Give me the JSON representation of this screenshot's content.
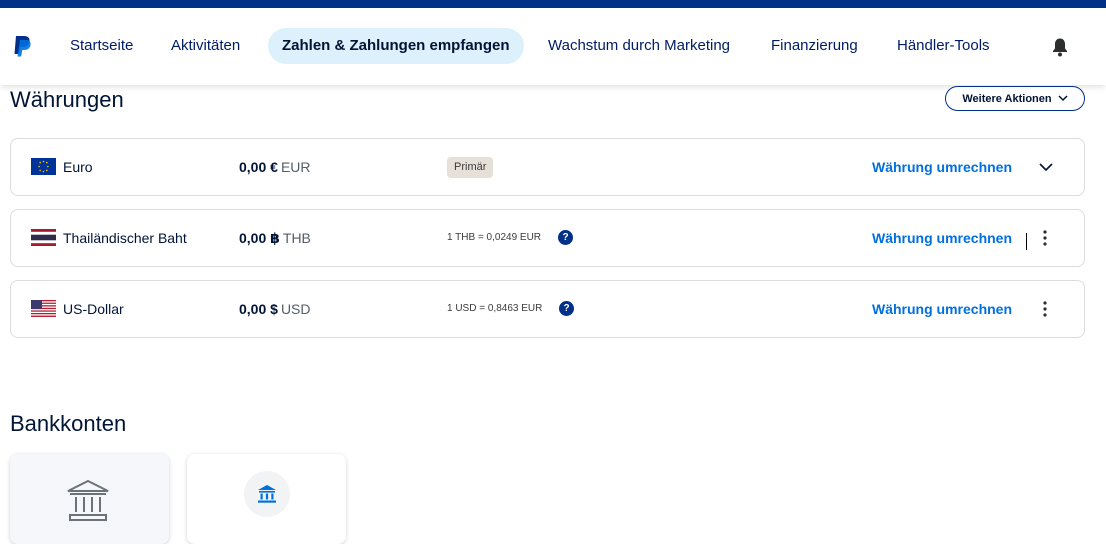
{
  "nav": {
    "items": [
      {
        "label": "Startseite",
        "active": false
      },
      {
        "label": "Aktivitäten",
        "active": false
      },
      {
        "label": "Zahlen & Zahlungen empfangen",
        "active": true
      },
      {
        "label": "Wachstum durch Marketing",
        "active": false
      },
      {
        "label": "Finanzierung",
        "active": false
      },
      {
        "label": "Händler-Tools",
        "active": false
      }
    ]
  },
  "currencies": {
    "title": "Währungen",
    "more_actions": "Weitere Aktionen",
    "items": [
      {
        "name": "Euro",
        "amount": "0,00 €",
        "code": "EUR",
        "badge": "Primär",
        "convert": "Währung umrechnen",
        "flag": "eu-flag-icon"
      },
      {
        "name": "Thailändischer Baht",
        "amount": "0,00 ฿",
        "code": "THB",
        "rate": "1 THB = 0,0249 EUR",
        "convert": "Währung umrechnen",
        "flag": "thailand-flag-icon"
      },
      {
        "name": "US-Dollar",
        "amount": "0,00 $",
        "code": "USD",
        "rate": "1 USD = 0,8463 EUR",
        "convert": "Währung umrechnen",
        "flag": "usa-flag-icon"
      }
    ]
  },
  "bank": {
    "title": "Bankkonten"
  },
  "colors": {
    "brand_dark": "#003087",
    "link_blue": "#0070e0",
    "active_nav_bg": "#dcf1fb"
  }
}
